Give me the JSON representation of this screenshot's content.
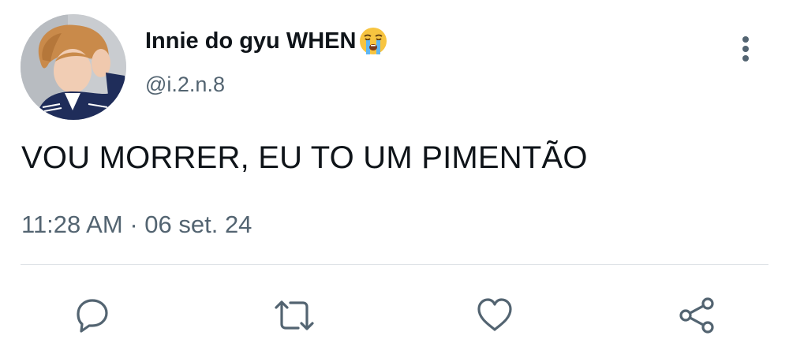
{
  "tweet": {
    "author": {
      "display_name": "Innie do gyu WHEN",
      "emoji": "loudly-crying-face",
      "handle": "@i.2.n.8",
      "avatar": "profile-photo"
    },
    "text": "VOU MORRER, EU TO UM PIMENTÃO",
    "time": "11:28 AM",
    "separator": "·",
    "date": "06 set. 24"
  },
  "actions": [
    {
      "icon": "reply-icon"
    },
    {
      "icon": "retweet-icon"
    },
    {
      "icon": "like-icon"
    },
    {
      "icon": "share-icon"
    }
  ],
  "colors": {
    "text": "#0f1419",
    "secondary": "#536471",
    "divider": "#dfe3e7"
  }
}
